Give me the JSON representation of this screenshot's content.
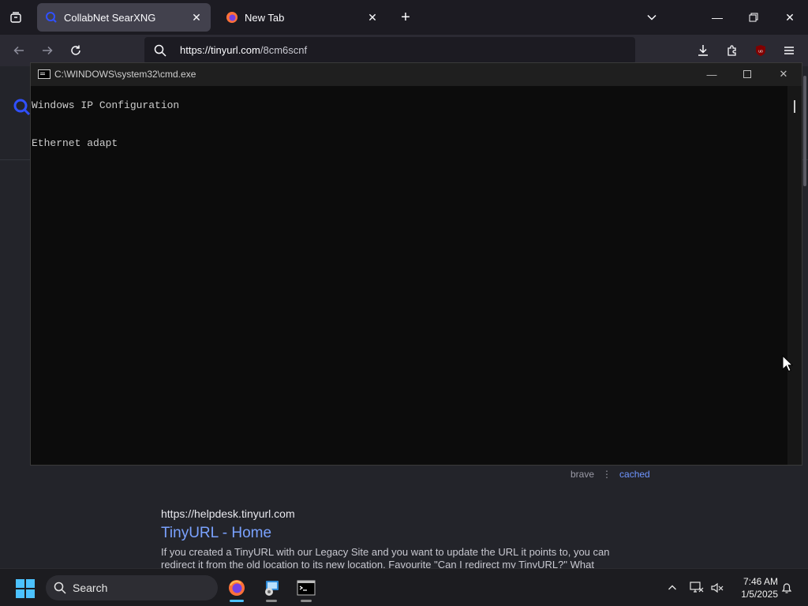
{
  "browser": {
    "tabs": [
      {
        "title": "CollabNet SearXNG",
        "active": true
      },
      {
        "title": "New Tab",
        "active": false
      }
    ],
    "url_host": "https://tinyurl.com",
    "url_path": "/8cm6scnf"
  },
  "page": {
    "result_meta": {
      "engine": "brave",
      "separator": "⋮",
      "cached_label": "cached"
    },
    "result": {
      "url": "https://helpdesk.tinyurl.com",
      "title": "TinyURL - Home",
      "snippet": "If you created a TinyURL with our Legacy Site and you want to update the URL it points to, you can redirect it from the old location to its new location. Favourite \"Can I redirect my TinyURL?\" What"
    }
  },
  "cmd": {
    "title": "C:\\WINDOWS\\system32\\cmd.exe",
    "lines": [
      "Windows IP Configuration",
      "",
      "",
      "Ethernet adapt"
    ]
  },
  "taskbar": {
    "search_label": "Search",
    "time": "7:46 AM",
    "date": "1/5/2025"
  },
  "colors": {
    "accent": "#4cc2ff",
    "link": "#7aa2ff"
  }
}
